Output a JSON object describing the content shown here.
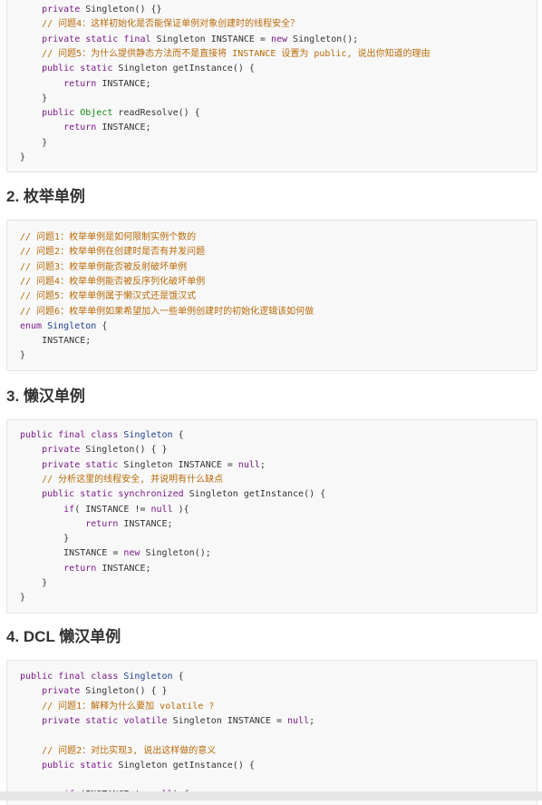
{
  "blocks": [
    {
      "lines": [
        [
          [
            "k",
            "    private "
          ],
          [
            "n",
            "Singleton() {}"
          ]
        ],
        [
          [
            "c",
            "    // 问题4：这样初始化是否能保证单例对象创建时的线程安全？"
          ]
        ],
        [
          [
            "k",
            "    private static final "
          ],
          [
            "n",
            "Singleton INSTANCE = "
          ],
          [
            "k",
            "new "
          ],
          [
            "n",
            "Singleton();"
          ]
        ],
        [
          [
            "c",
            "    // 问题5：为什么提供静态方法而不是直接将 INSTANCE 设置为 public, 说出你知道的理由"
          ]
        ],
        [
          [
            "k",
            "    public static "
          ],
          [
            "n",
            "Singleton getInstance() {"
          ]
        ],
        [
          [
            "k",
            "        return "
          ],
          [
            "n",
            "INSTANCE;"
          ]
        ],
        [
          [
            "n",
            "    }"
          ]
        ],
        [
          [
            "k",
            "    public "
          ],
          [
            "o",
            "Object "
          ],
          [
            "n",
            "readResolve() {"
          ]
        ],
        [
          [
            "k",
            "        return "
          ],
          [
            "n",
            "INSTANCE;"
          ]
        ],
        [
          [
            "n",
            "    }"
          ]
        ],
        [
          [
            "n",
            "}"
          ]
        ]
      ]
    },
    {
      "lines": [
        [
          [
            "c",
            "// 问题1：枚举单例是如何限制实例个数的"
          ]
        ],
        [
          [
            "c",
            "// 问题2：枚举单例在创建时是否有并发问题"
          ]
        ],
        [
          [
            "c",
            "// 问题3：枚举单例能否被反射破坏单例"
          ]
        ],
        [
          [
            "c",
            "// 问题4：枚举单例能否被反序列化破坏单例"
          ]
        ],
        [
          [
            "c",
            "// 问题5：枚举单例属于懒汉式还是饿汉式"
          ]
        ],
        [
          [
            "c",
            "// 问题6：枚举单例如果希望加入一些单例创建时的初始化逻辑该如何做"
          ]
        ],
        [
          [
            "k",
            "enum "
          ],
          [
            "t",
            "Singleton "
          ],
          [
            "n",
            "{"
          ]
        ],
        [
          [
            "n",
            "    INSTANCE;"
          ]
        ],
        [
          [
            "n",
            "}"
          ]
        ]
      ]
    },
    {
      "lines": [
        [
          [
            "k",
            "public final class "
          ],
          [
            "t",
            "Singleton "
          ],
          [
            "n",
            "{"
          ]
        ],
        [
          [
            "k",
            "    private "
          ],
          [
            "n",
            "Singleton() { }"
          ]
        ],
        [
          [
            "k",
            "    private static "
          ],
          [
            "n",
            "Singleton INSTANCE = "
          ],
          [
            "k",
            "null"
          ],
          [
            "n",
            ";"
          ]
        ],
        [
          [
            "c",
            "    // 分析这里的线程安全, 并说明有什么缺点"
          ]
        ],
        [
          [
            "k",
            "    public static synchronized "
          ],
          [
            "n",
            "Singleton getInstance() {"
          ]
        ],
        [
          [
            "k",
            "        if"
          ],
          [
            "n",
            "( INSTANCE != "
          ],
          [
            "k",
            "null "
          ],
          [
            "n",
            "){"
          ]
        ],
        [
          [
            "k",
            "            return "
          ],
          [
            "n",
            "INSTANCE;"
          ]
        ],
        [
          [
            "n",
            "        }"
          ]
        ],
        [
          [
            "n",
            "        INSTANCE = "
          ],
          [
            "k",
            "new "
          ],
          [
            "n",
            "Singleton();"
          ]
        ],
        [
          [
            "k",
            "        return "
          ],
          [
            "n",
            "INSTANCE;"
          ]
        ],
        [
          [
            "n",
            "    }"
          ]
        ],
        [
          [
            "n",
            "}"
          ]
        ]
      ]
    },
    {
      "lines": [
        [
          [
            "k",
            "public final class "
          ],
          [
            "t",
            "Singleton "
          ],
          [
            "n",
            "{"
          ]
        ],
        [
          [
            "k",
            "    private "
          ],
          [
            "n",
            "Singleton() { }"
          ]
        ],
        [
          [
            "c",
            "    // 问题1：解释为什么要加 volatile ?"
          ]
        ],
        [
          [
            "k",
            "    private static volatile "
          ],
          [
            "n",
            "Singleton INSTANCE = "
          ],
          [
            "k",
            "null"
          ],
          [
            "n",
            ";"
          ]
        ],
        [
          [
            "n",
            ""
          ]
        ],
        [
          [
            "c",
            "    // 问题2：对比实现3, 说出这样做的意义"
          ]
        ],
        [
          [
            "k",
            "    public static "
          ],
          [
            "n",
            "Singleton getInstance() {"
          ]
        ],
        [
          [
            "n",
            ""
          ]
        ],
        [
          [
            "k",
            "        if "
          ],
          [
            "n",
            "(INSTANCE != "
          ],
          [
            "k",
            "null"
          ],
          [
            "n",
            ") {"
          ]
        ]
      ]
    }
  ],
  "headings": {
    "h2": "2. 枚举单例",
    "h3": "3. 懒汉单例",
    "h4": "4. DCL 懒汉单例"
  },
  "colors": {
    "keyword": "#7b1a88",
    "comment": "#b86a08",
    "type": "#1e3f8f",
    "object": "#118a11",
    "text": "#333333",
    "code_bg": "#f8f8f8"
  }
}
